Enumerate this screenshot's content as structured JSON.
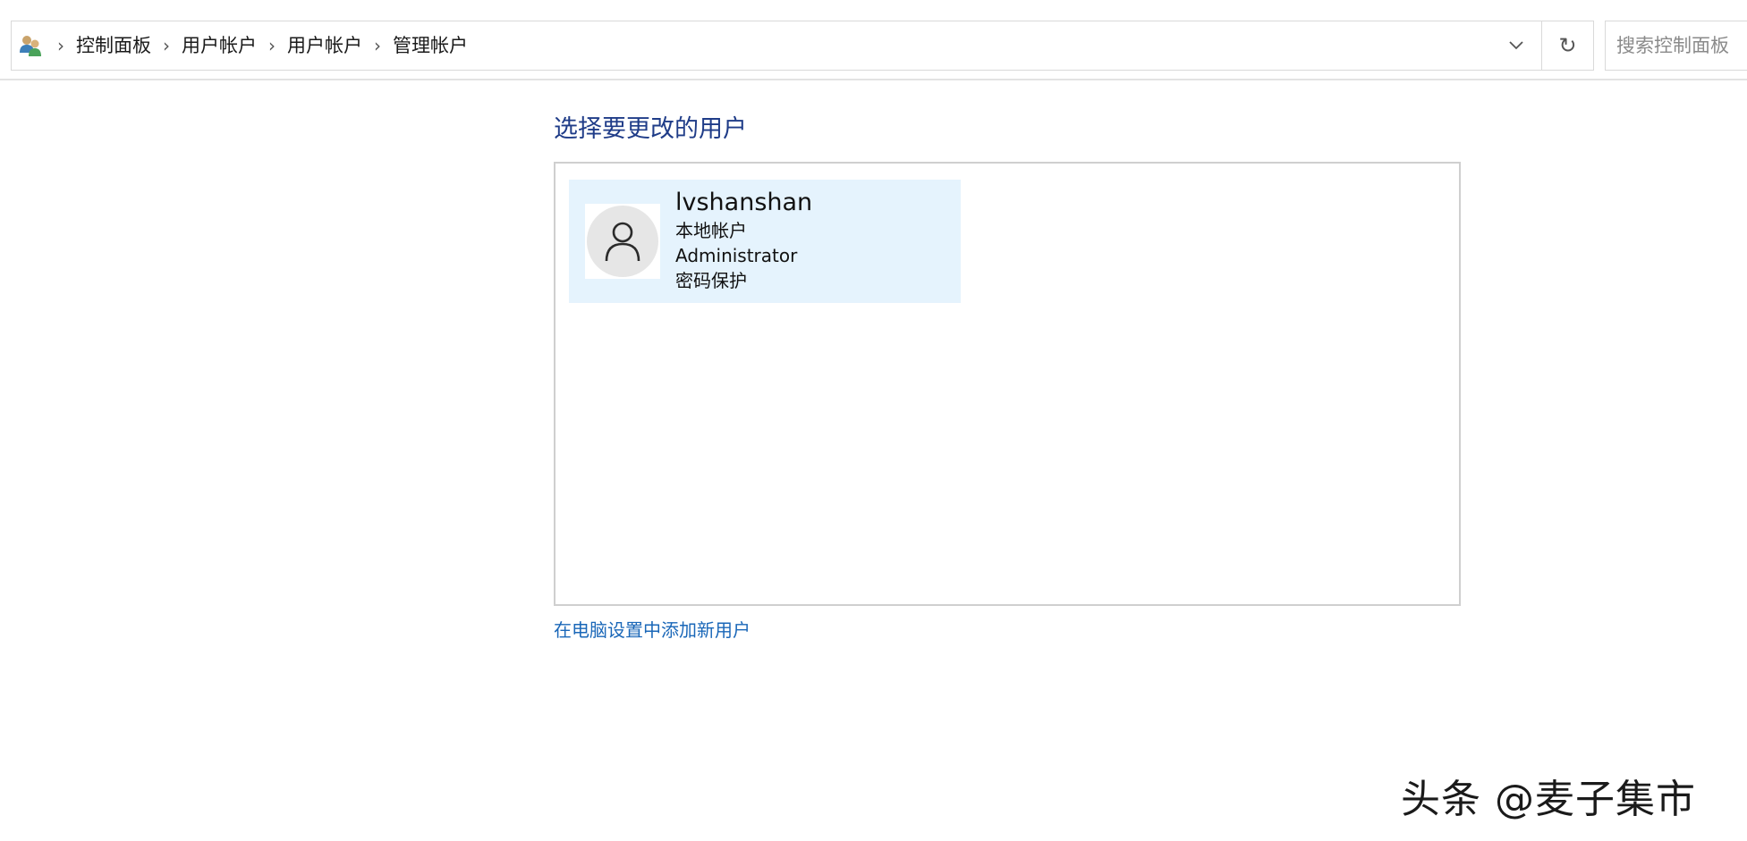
{
  "address_bar": {
    "breadcrumbs": [
      "控制面板",
      "用户帐户",
      "用户帐户",
      "管理帐户"
    ],
    "search_placeholder": "搜索控制面板"
  },
  "main": {
    "title": "选择要更改的用户",
    "users": [
      {
        "name": "lvshanshan",
        "type": "本地帐户",
        "role": "Administrator",
        "security": "密码保护"
      }
    ],
    "add_user_link": "在电脑设置中添加新用户"
  },
  "watermark": "头条 @麦子集市",
  "colors": {
    "title": "#1f3c88",
    "link": "#1a67b8",
    "tile_bg": "#e5f3fd",
    "border": "#cfcfcf"
  },
  "icons": {
    "address": "users-icon",
    "separator": "chevron-right-icon",
    "dropdown": "chevron-down-icon",
    "refresh": "refresh-icon",
    "avatar": "user-avatar-icon"
  }
}
